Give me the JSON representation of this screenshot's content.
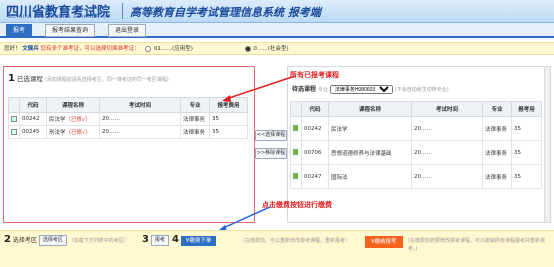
{
  "header": {
    "logo_cn": "四川省教育考试院",
    "logo_en": "SICHUAN EDUCATIONAL EXAMINATION",
    "system_title": "高等教育自学考试管理信息系统",
    "system_sub": "报考端"
  },
  "tabs": [
    {
      "label": "报考"
    },
    {
      "label": "报考结果查询"
    },
    {
      "label": "退出登录"
    }
  ],
  "notice": {
    "greeting": "您好！",
    "name": "文佩兵",
    "warn": "您有多个准考证，可以选择切换准考证：",
    "option1": "01……(应用型)",
    "option2": "0……(社会型)"
  },
  "left_panel": {
    "step": "1",
    "title": "已选课程",
    "hint": "(添加课程前请先选择考区，同一准考证的同一考区课程)",
    "headers": [
      "代码",
      "课程名称",
      "考试时间",
      "专业",
      "报考费用"
    ],
    "rows": [
      {
        "code": "00242",
        "name": "民法学",
        "tag": "（已修√）",
        "time": "20……",
        "major": "法律事务",
        "fee": "35"
      },
      {
        "code": "00245",
        "name": "刑法学",
        "tag": "（已修√）",
        "time": "20……",
        "major": "法律事务",
        "fee": "35"
      }
    ]
  },
  "middle": {
    "add_label": "<<选择课程",
    "remove_label": ">>移除课程"
  },
  "right_panel": {
    "filter_label": "待选课程",
    "major_label": "专业",
    "major_value": "法律事务H080603",
    "hint": "(不会自动考生切换专业)",
    "headers": [
      "代码",
      "课程名称",
      "考试时间",
      "专业",
      "报考用"
    ],
    "rows": [
      {
        "code": "00242",
        "name": "民法学",
        "time": "20……",
        "major": "法律事务",
        "fee": "35"
      },
      {
        "code": "00706",
        "name": "思想道德修养与法律基础",
        "time": "20……",
        "major": "法律事务",
        "fee": "35"
      },
      {
        "code": "00247",
        "name": "国际法",
        "time": "20……",
        "major": "法律事务",
        "fee": "35"
      }
    ]
  },
  "annotations": {
    "all_courses": "所有已报考课程",
    "click_pay": "点击缴费按钮进行缴费"
  },
  "bottom": {
    "step2": "2",
    "area_label": "选择考区",
    "area_btn": "选择考区",
    "area_hint": "（加载下方列表中的考区）",
    "step3": "3",
    "report_btn": "报考",
    "step4": "4",
    "pay_btn": "¥缴费下单",
    "pay_notice": "（在缴费前，可以重新修改报考课程，重新报考）",
    "orange_btn": "¥缴纳报考",
    "right_notice": "(在缴费前若要修改报考课程，可以撤销所有课程报考并重新报考。)"
  }
}
